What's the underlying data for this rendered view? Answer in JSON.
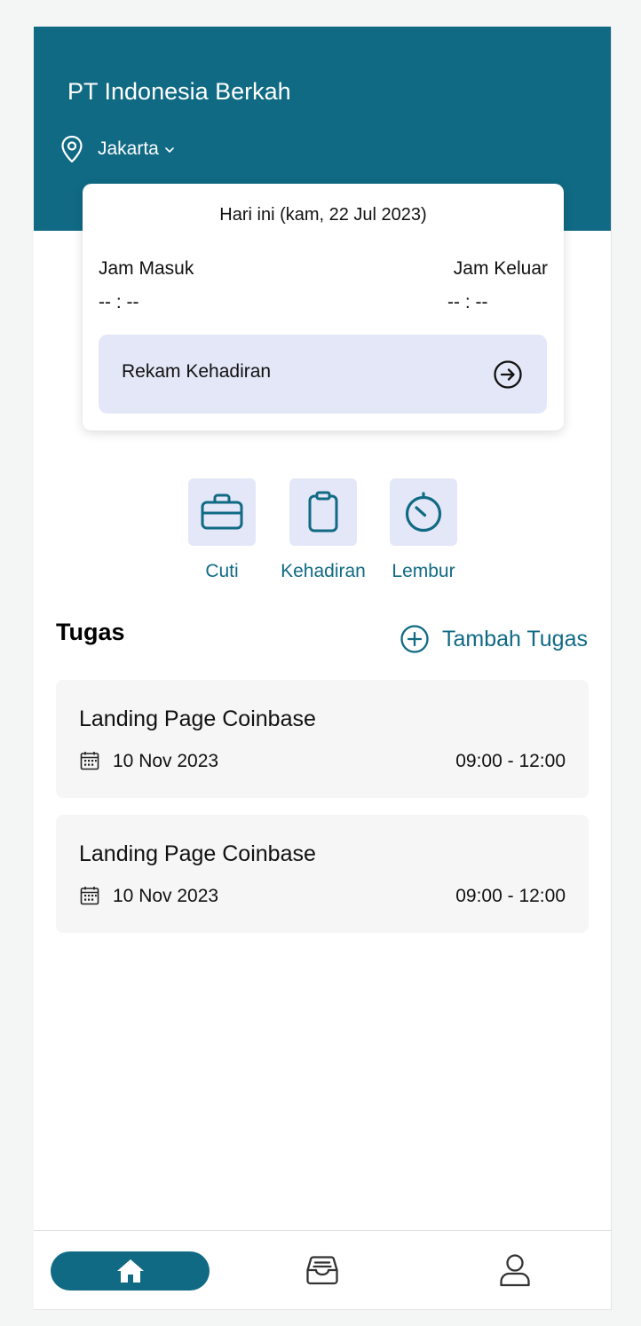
{
  "header": {
    "company": "PT Indonesia Berkah",
    "location": "Jakarta",
    "icons": {
      "location": "location-pin-icon",
      "dropdown": "chevron-down-icon"
    },
    "colors": {
      "primary": "#106a84"
    }
  },
  "attendance_card": {
    "today": "Hari ini (kam, 22 Jul 2023)",
    "check_in_label": "Jam Masuk",
    "check_in_value": "-- : --",
    "check_out_label": "Jam Keluar",
    "check_out_value": "-- : --",
    "record_button": "Rekam Kehadiran",
    "record_icon": "arrow-right-circle-icon"
  },
  "quick_actions": [
    {
      "label": "Cuti",
      "icon": "briefcase-icon"
    },
    {
      "label": "Kehadiran",
      "icon": "clipboard-icon"
    },
    {
      "label": "Lembur",
      "icon": "timer-icon"
    }
  ],
  "tasks_section": {
    "title": "Tugas",
    "add_button": "Tambah Tugas",
    "add_icon": "plus-circle-icon",
    "items": [
      {
        "title": "Landing Page Coinbase",
        "date": "10 Nov 2023",
        "time": "09:00 - 12:00",
        "icon": "calendar-icon"
      },
      {
        "title": "Landing Page Coinbase",
        "date": "10 Nov 2023",
        "time": "09:00 - 12:00",
        "icon": "calendar-icon"
      }
    ]
  },
  "bottom_nav": {
    "items": [
      {
        "name": "home",
        "icon": "home-icon",
        "active": true
      },
      {
        "name": "inbox",
        "icon": "inbox-icon",
        "active": false
      },
      {
        "name": "profile",
        "icon": "user-icon",
        "active": false
      }
    ]
  }
}
